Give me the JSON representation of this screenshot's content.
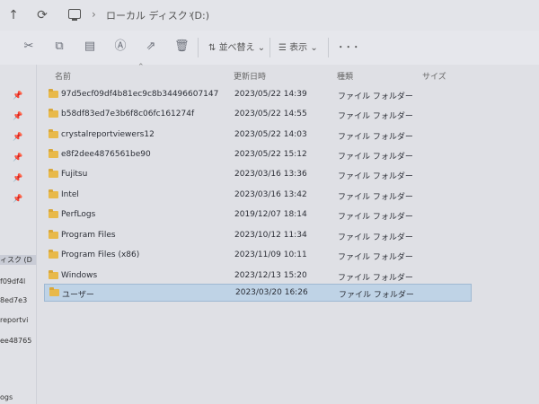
{
  "address": {
    "drive_label": "ローカル ディスク (D:)"
  },
  "toolbar": {
    "sort_label": "並べ替え",
    "view_label": "表示",
    "more_label": "･･･"
  },
  "columns": {
    "name": "名前",
    "date": "更新日時",
    "type": "種類",
    "size": "サイズ"
  },
  "rows": [
    {
      "name": "97d5ecf09df4b81ec9c8b34496607147",
      "date": "2023/05/22 14:39",
      "type": "ファイル フォルダー"
    },
    {
      "name": "b58df83ed7e3b6f8c06fc161274f",
      "date": "2023/05/22 14:55",
      "type": "ファイル フォルダー"
    },
    {
      "name": "crystalreportviewers12",
      "date": "2023/05/22 14:03",
      "type": "ファイル フォルダー"
    },
    {
      "name": "e8f2dee4876561be90",
      "date": "2023/05/22 15:12",
      "type": "ファイル フォルダー"
    },
    {
      "name": "Fujitsu",
      "date": "2023/03/16 13:36",
      "type": "ファイル フォルダー"
    },
    {
      "name": "Intel",
      "date": "2023/03/16 13:42",
      "type": "ファイル フォルダー"
    },
    {
      "name": "PerfLogs",
      "date": "2019/12/07 18:14",
      "type": "ファイル フォルダー"
    },
    {
      "name": "Program Files",
      "date": "2023/10/12 11:34",
      "type": "ファイル フォルダー"
    },
    {
      "name": "Program Files (x86)",
      "date": "2023/11/09 10:11",
      "type": "ファイル フォルダー"
    },
    {
      "name": "Windows",
      "date": "2023/12/13 15:20",
      "type": "ファイル フォルダー"
    },
    {
      "name": "ユーザー",
      "date": "2023/03/20 16:26",
      "type": "ファイル フォルダー"
    }
  ],
  "selected_row": 10,
  "navpane": {
    "fragments": [
      "ィスク (D",
      "f09df4l",
      "8ed7e3",
      "reportvi",
      "ee48765",
      "ogs"
    ]
  },
  "colors": {
    "selection": "#bfd3e6",
    "folder": "#e8b94a"
  }
}
